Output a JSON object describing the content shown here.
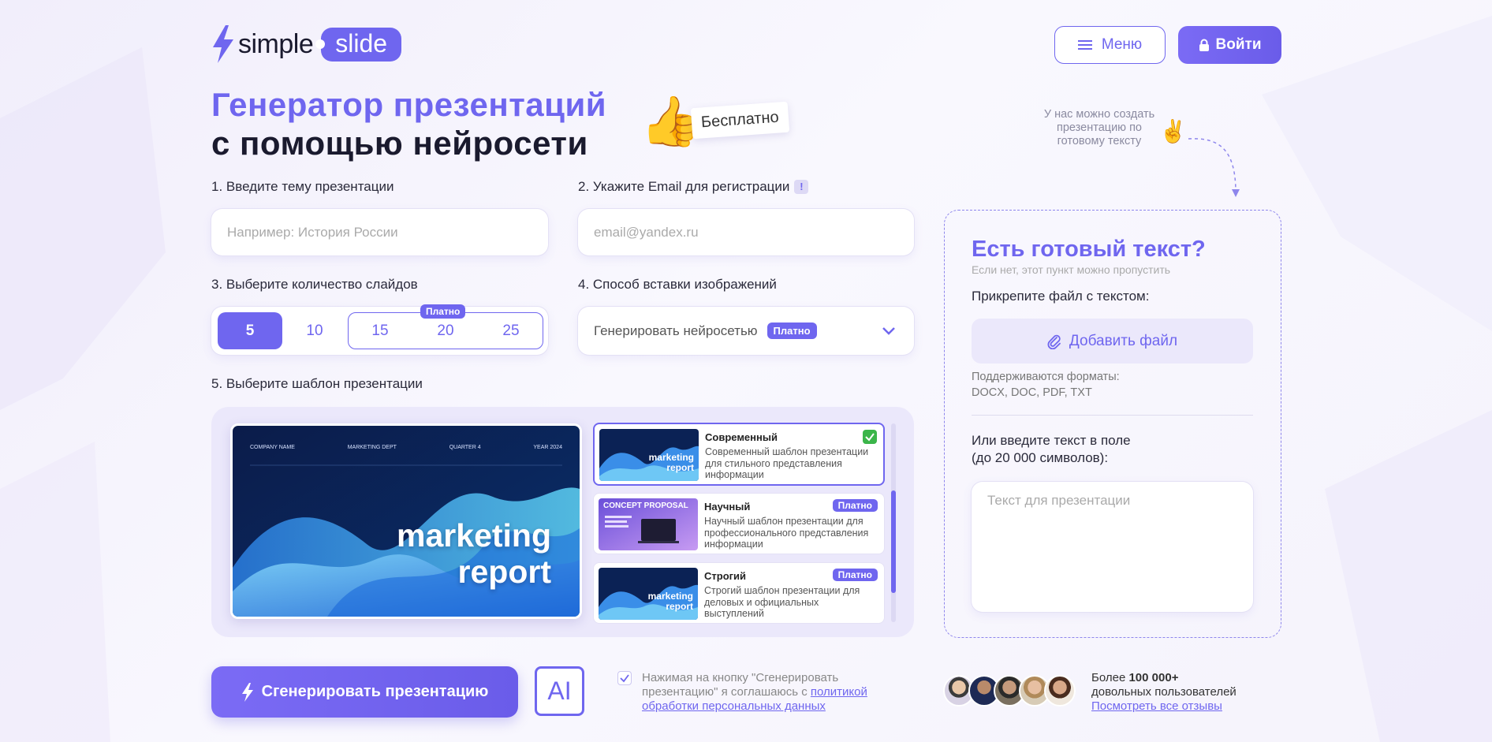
{
  "header": {
    "logo_part1": "simple",
    "logo_part2": "slide",
    "menu_label": "Меню",
    "login_label": "Войти"
  },
  "hero": {
    "title_line1": "Генератор презентаций",
    "title_line2": "с помощью нейросети",
    "free_tag": "Бесплатно",
    "hint_note": "У нас можно создать презентацию по готовому тексту"
  },
  "form": {
    "topic_label": "1. Введите тему презентации",
    "topic_placeholder": "Например: История России",
    "email_label": "2. Укажите Email для регистрации",
    "email_help": "!",
    "email_placeholder": "email@yandex.ru",
    "slides_label": "3. Выберите количество слайдов",
    "slides_options": [
      "5",
      "10",
      "15",
      "20",
      "25"
    ],
    "slides_selected": "5",
    "slides_paid_badge": "Платно",
    "images_label": "4. Способ вставки изображений",
    "images_selected": "Генерировать нейросетью",
    "images_badge": "Платно",
    "template_label": "5. Выберите шаблон презентации"
  },
  "preview": {
    "header_items": [
      "COMPANY NAME",
      "MARKETING DEPT",
      "QUARTER 4",
      "YEAR 2024"
    ],
    "title_line1": "marketing",
    "title_line2": "report"
  },
  "templates": [
    {
      "name": "Современный",
      "description": "Современный шаблон презентации для стильного представления информации",
      "thumb_line1": "marketing",
      "thumb_line2": "report",
      "selected": true
    },
    {
      "name": "Научный",
      "description": "Научный шаблон презентации для профессионального представления информации",
      "badge": "Платно",
      "thumb_title": "CONCEPT PROPOSAL",
      "selected": false
    },
    {
      "name": "Строгий",
      "description": "Строгий шаблон презентации для деловых и официальных выступлений",
      "badge": "Платно",
      "thumb_line1": "marketing",
      "thumb_line2": "report",
      "selected": false
    }
  ],
  "right_panel": {
    "title": "Есть готовый текст?",
    "subtitle": "Если нет, этот пункт можно пропустить",
    "attach_label": "Прикрепите файл с текстом:",
    "add_file_label": "Добавить файл",
    "formats_line1": "Поддерживаются форматы:",
    "formats_line2": "DOCX, DOC, PDF, TXT",
    "or_line1": "Или введите текст в поле",
    "or_line2": "(до 20 000 символов):",
    "text_placeholder": "Текст для презентации"
  },
  "bottom": {
    "generate_label": "Сгенерировать презентацию",
    "ai_label": "AI",
    "agree_text": "Нажимая на кнопку \"Сгенерировать презентацию\" я соглашаюсь с ",
    "agree_link": "политикой обработки персональных данных",
    "users_prefix": "Более ",
    "users_count": "100 000+",
    "users_suffix": "довольных пользователей",
    "reviews_link": "Посмотреть все отзывы"
  },
  "colors": {
    "accent": "#6f66ef",
    "success": "#3bb54a"
  }
}
